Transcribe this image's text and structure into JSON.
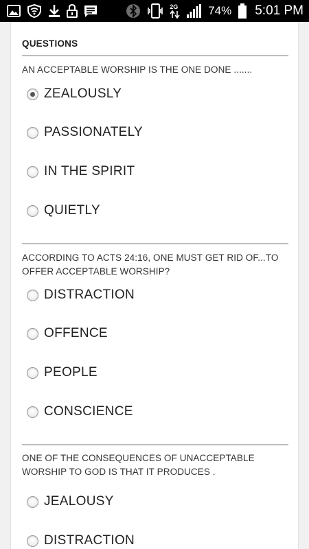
{
  "status_bar": {
    "network_type": "2G",
    "battery_percent": "74%",
    "time": "5:01 PM"
  },
  "quiz": {
    "section_title": "QUESTIONS",
    "questions": [
      {
        "text": "AN ACCEPTABLE WORSHIP IS THE ONE DONE .......",
        "options": [
          "ZEALOUSLY",
          "PASSIONATELY",
          "IN THE SPIRIT",
          "QUIETLY"
        ],
        "selected": 0
      },
      {
        "text": "ACCORDING TO ACTS 24:16, ONE MUST GET RID OF...TO OFFER ACCEPTABLE WORSHIP?",
        "options": [
          "DISTRACTION",
          "OFFENCE",
          "PEOPLE",
          "CONSCIENCE"
        ],
        "selected": null
      },
      {
        "text": "ONE OF THE CONSEQUENCES OF UNACCEPTABLE WORSHIP TO GOD IS THAT IT PRODUCES .",
        "options": [
          "JEALOUSY",
          "DISTRACTION"
        ],
        "selected": null
      }
    ]
  }
}
